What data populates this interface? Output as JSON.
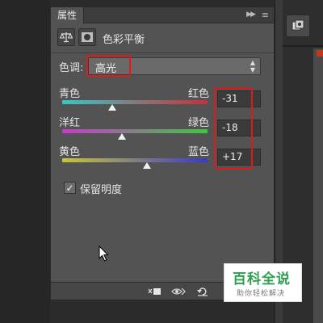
{
  "panel": {
    "tab_label": "属性",
    "title": "色彩平衡",
    "menu_icon": "panel-menu-icon",
    "collapse_icon": "collapse-icon"
  },
  "tone": {
    "label": "色调:",
    "value": "高光"
  },
  "sliders": [
    {
      "left": "青色",
      "right": "红色",
      "value": "-31",
      "level": -31,
      "colors": [
        "#38c8c4",
        "#c8303a"
      ]
    },
    {
      "left": "洋红",
      "right": "绿色",
      "value": "-18",
      "level": -18,
      "colors": [
        "#c83acb",
        "#3ec83f"
      ]
    },
    {
      "left": "黄色",
      "right": "蓝色",
      "value": "+17",
      "level": 17,
      "colors": [
        "#c8c63a",
        "#3a3ac8"
      ]
    }
  ],
  "preserve_luminosity": {
    "label": "保留明度",
    "checked": true
  },
  "watermark": {
    "title": "百科全说",
    "subtitle": "助你轻松解决"
  },
  "colors": {
    "highlight": "#e01919",
    "panel_bg": "#535353"
  }
}
